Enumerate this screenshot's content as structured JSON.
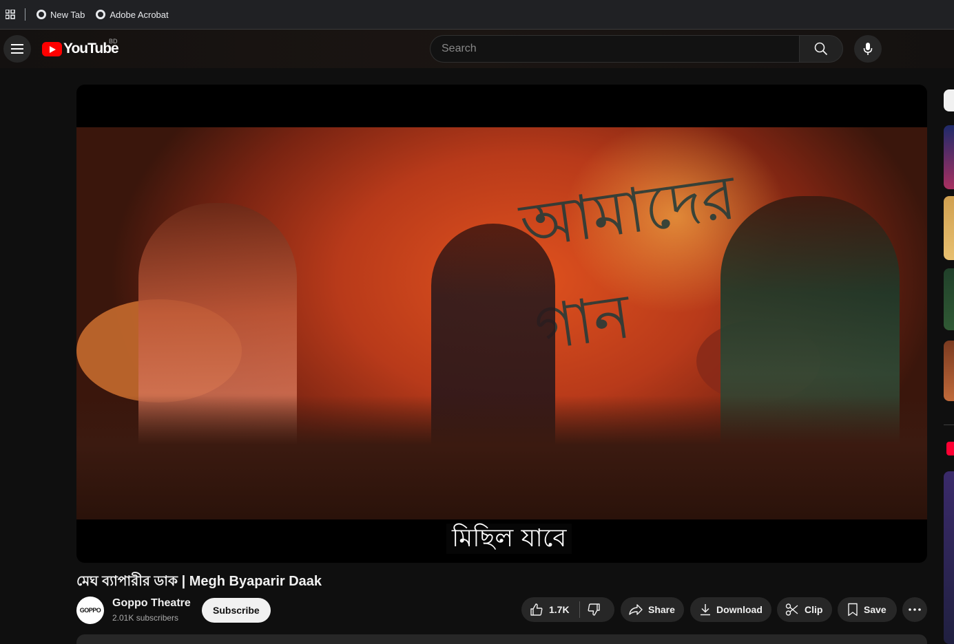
{
  "bookmarks": {
    "items": [
      {
        "label": "New Tab",
        "icon": "globe-icon"
      },
      {
        "label": "Adobe Acrobat",
        "icon": "globe-icon"
      }
    ]
  },
  "masthead": {
    "logo_text": "YouTube",
    "country_code": "BD",
    "search_placeholder": "Search"
  },
  "player": {
    "caption": "মিছিল যাবে"
  },
  "video": {
    "title": "মেঘ ব্যাপারীর ডাক | Megh Byaparir Daak",
    "channel": {
      "name": "Goppo Theatre",
      "subscribers": "2.01K subscribers",
      "avatar_text": "GOPPO"
    },
    "subscribe_label": "Subscribe",
    "actions": {
      "likes": "1.7K",
      "share": "Share",
      "download": "Download",
      "clip": "Clip",
      "save": "Save"
    }
  },
  "colors": {
    "background": "#0f0f0f",
    "brand_red": "#ff0000",
    "pill_bg": "#272727",
    "subscribe_bg": "#f1f1f1"
  }
}
